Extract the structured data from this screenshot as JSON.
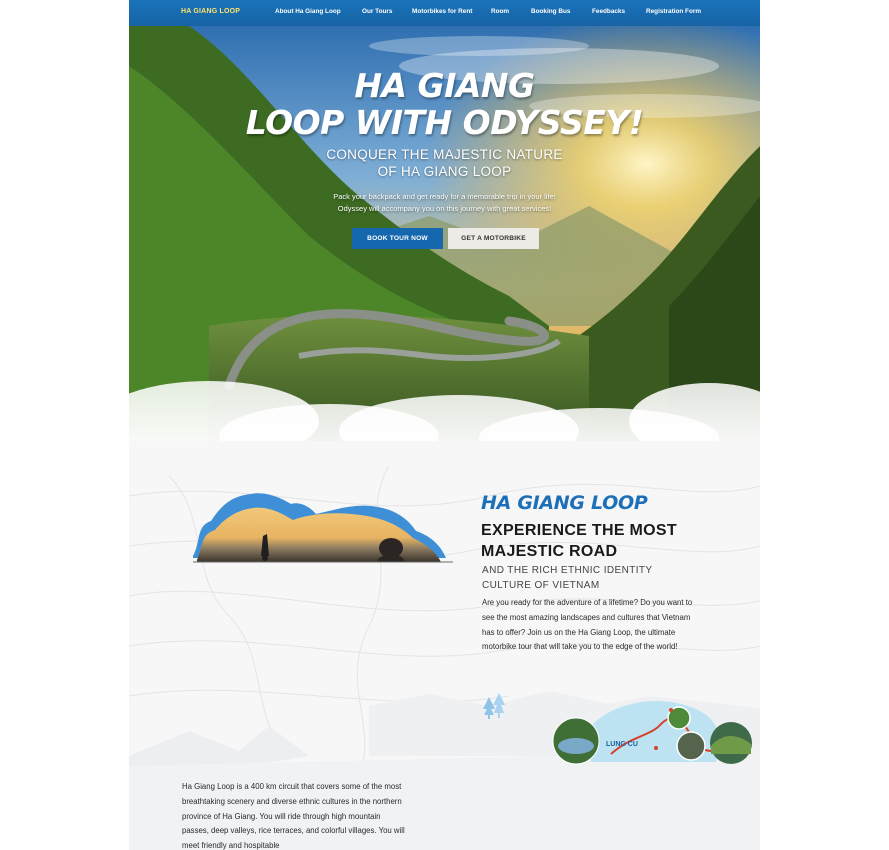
{
  "nav": {
    "brand": "HA GIANG LOOP",
    "links": [
      "About Ha Giang Loop",
      "Our Tours",
      "Motorbikes for Rent",
      "Room",
      "Booking Bus",
      "Feedbacks",
      "Registration Form"
    ]
  },
  "hero": {
    "title_line1": "HA GIANG",
    "title_line2": "LOOP WITH ODYSSEY!",
    "subtitle_line1": "CONQUER THE MAJESTIC NATURE",
    "subtitle_line2": "OF HA GIANG LOOP",
    "desc_line1": "Pack your backpack and get ready for a memorable trip in your life!",
    "desc_line2": "Odyssey will accompany you on this journey with great services!",
    "btn_book": "BOOK TOUR NOW",
    "btn_motorbike": "GET A MOTORBIKE"
  },
  "intro": {
    "script_title": "HA GIANG LOOP",
    "heading_line1": "EXPERIENCE THE MOST",
    "heading_line2": "MAJESTIC ROAD",
    "sub_line1": "AND THE RICH ETHNIC IDENTITY",
    "sub_line2": "CULTURE OF VIETNAM",
    "body": "Are you ready for the adventure of a lifetime? Do you want to see the most amazing landscapes and cultures that Vietnam has to offer? Join us on the Ha Giang Loop, the ultimate motorbike tour that will take you to the edge of the world!"
  },
  "map": {
    "label_lungcu": "LUNG CU"
  },
  "about": {
    "body": "Ha Giang Loop is a 400 km circuit that covers some of the most breathtaking scenery and diverse ethnic cultures in the northern province of Ha Giang. You will ride through high mountain passes, deep valleys, rice terraces, and colorful villages. You will meet friendly and hospitable"
  },
  "colors": {
    "nav": "#1a73b9",
    "brand": "#ffe36a",
    "accent": "#1d6fb8",
    "button_primary": "#1567ae"
  }
}
